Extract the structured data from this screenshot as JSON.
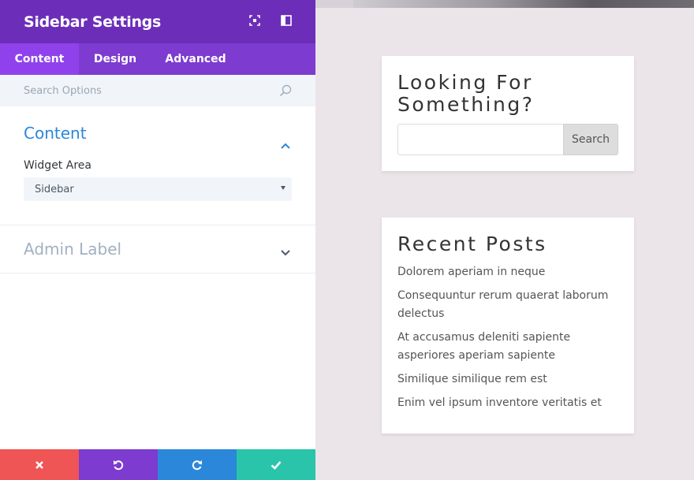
{
  "panel": {
    "title": "Sidebar Settings",
    "header_icons": [
      "expand-icon",
      "split-view-icon"
    ],
    "tabs": [
      {
        "label": "Content",
        "active": true
      },
      {
        "label": "Design",
        "active": false
      },
      {
        "label": "Advanced",
        "active": false
      }
    ],
    "search": {
      "placeholder": "Search Options",
      "icon": "search-icon"
    },
    "sections": {
      "content": {
        "title": "Content",
        "expanded": true,
        "field_label": "Widget Area",
        "select_value": "Sidebar"
      },
      "admin": {
        "title": "Admin Label",
        "expanded": false
      }
    },
    "footer": {
      "buttons": [
        "discard-icon",
        "undo-icon",
        "redo-icon",
        "save-check-icon"
      ]
    }
  },
  "preview": {
    "search_widget": {
      "title": "Looking For Something?",
      "button_label": "Search"
    },
    "recent_posts": {
      "title": "Recent Posts",
      "items": [
        "Dolorem aperiam in neque",
        "Consequuntur rerum quaerat laborum delectus",
        "At accusamus deleniti sapiente asperiores aperiam sapiente",
        "Similique similique rem est",
        "Enim vel ipsum inventore veritatis et"
      ]
    }
  },
  "colors": {
    "header": "#6c2eb9",
    "tabs": "#7e3bd0",
    "active_tab": "#8f42ec",
    "accent_blue": "#2b87da",
    "discard": "#ef5555",
    "save": "#29c4a9",
    "preview_bg": "#ebe4e9"
  }
}
